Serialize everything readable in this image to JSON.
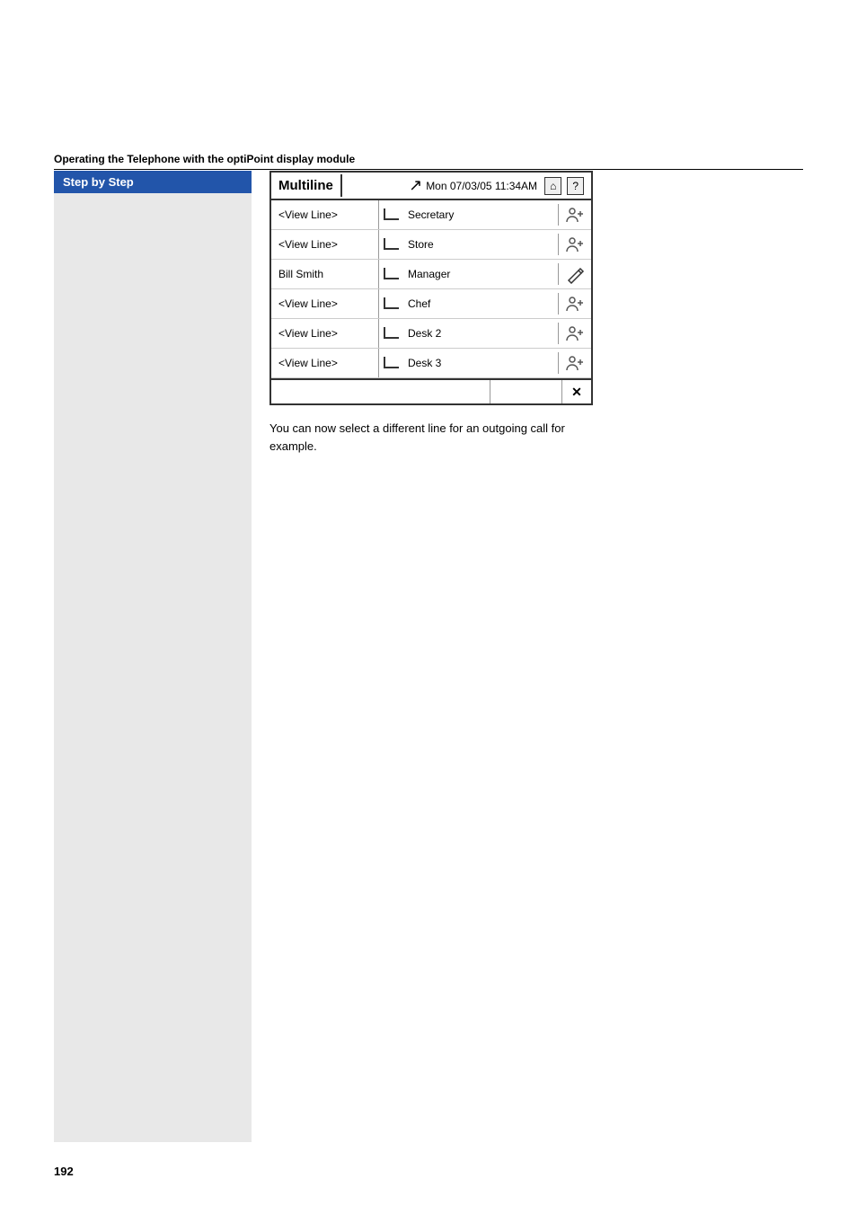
{
  "page": {
    "number": "192",
    "section_heading": "Operating the Telephone with the optiPoint display module"
  },
  "sidebar": {
    "label": "Step by Step"
  },
  "phone": {
    "title": "Multiline",
    "datetime": "Mon 07/03/05 11:34AM",
    "home_btn": "⌂",
    "help_btn": "?",
    "call_icon": "↙",
    "lines": [
      {
        "left": "<View Line>",
        "label": "Secretary",
        "icon": "📞",
        "icon_type": "phone",
        "active": false
      },
      {
        "left": "<View Line>",
        "label": "Store",
        "icon": "📞",
        "icon_type": "phone",
        "active": false
      },
      {
        "left": "Bill Smith",
        "label": "Manager",
        "icon": "✏️",
        "icon_type": "edit",
        "active": true
      },
      {
        "left": "<View Line>",
        "label": "Chef",
        "icon": "📞",
        "icon_type": "phone",
        "active": false
      },
      {
        "left": "<View Line>",
        "label": "Desk 2",
        "icon": "📞",
        "icon_type": "phone",
        "active": false
      },
      {
        "left": "<View Line>",
        "label": "Desk 3",
        "icon": "📞",
        "icon_type": "phone",
        "active": false
      }
    ],
    "bottom_close": "✕"
  },
  "description": "You can now select a different line for an outgoing call for example."
}
